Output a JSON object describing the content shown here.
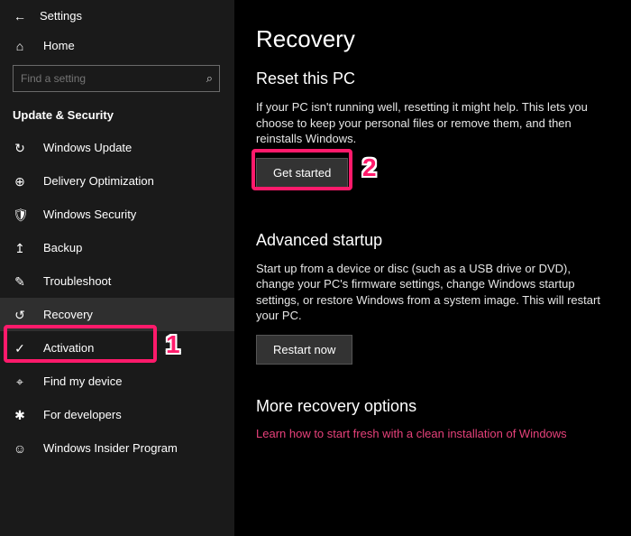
{
  "header": {
    "title": "Settings"
  },
  "home": {
    "label": "Home"
  },
  "search": {
    "placeholder": "Find a setting"
  },
  "section": {
    "label": "Update & Security"
  },
  "nav": [
    {
      "label": "Windows Update"
    },
    {
      "label": "Delivery Optimization"
    },
    {
      "label": "Windows Security"
    },
    {
      "label": "Backup"
    },
    {
      "label": "Troubleshoot"
    },
    {
      "label": "Recovery"
    },
    {
      "label": "Activation"
    },
    {
      "label": "Find my device"
    },
    {
      "label": "For developers"
    },
    {
      "label": "Windows Insider Program"
    }
  ],
  "main": {
    "title": "Recovery",
    "reset": {
      "heading": "Reset this PC",
      "body": "If your PC isn't running well, resetting it might help. This lets you choose to keep your personal files or remove them, and then reinstalls Windows.",
      "button": "Get started"
    },
    "advanced": {
      "heading": "Advanced startup",
      "body": "Start up from a device or disc (such as a USB drive or DVD), change your PC's firmware settings, change Windows startup settings, or restore Windows from a system image. This will restart your PC.",
      "button": "Restart now"
    },
    "more": {
      "heading": "More recovery options",
      "link": "Learn how to start fresh with a clean installation of Windows"
    }
  },
  "annotations": {
    "one": "1",
    "two": "2"
  }
}
